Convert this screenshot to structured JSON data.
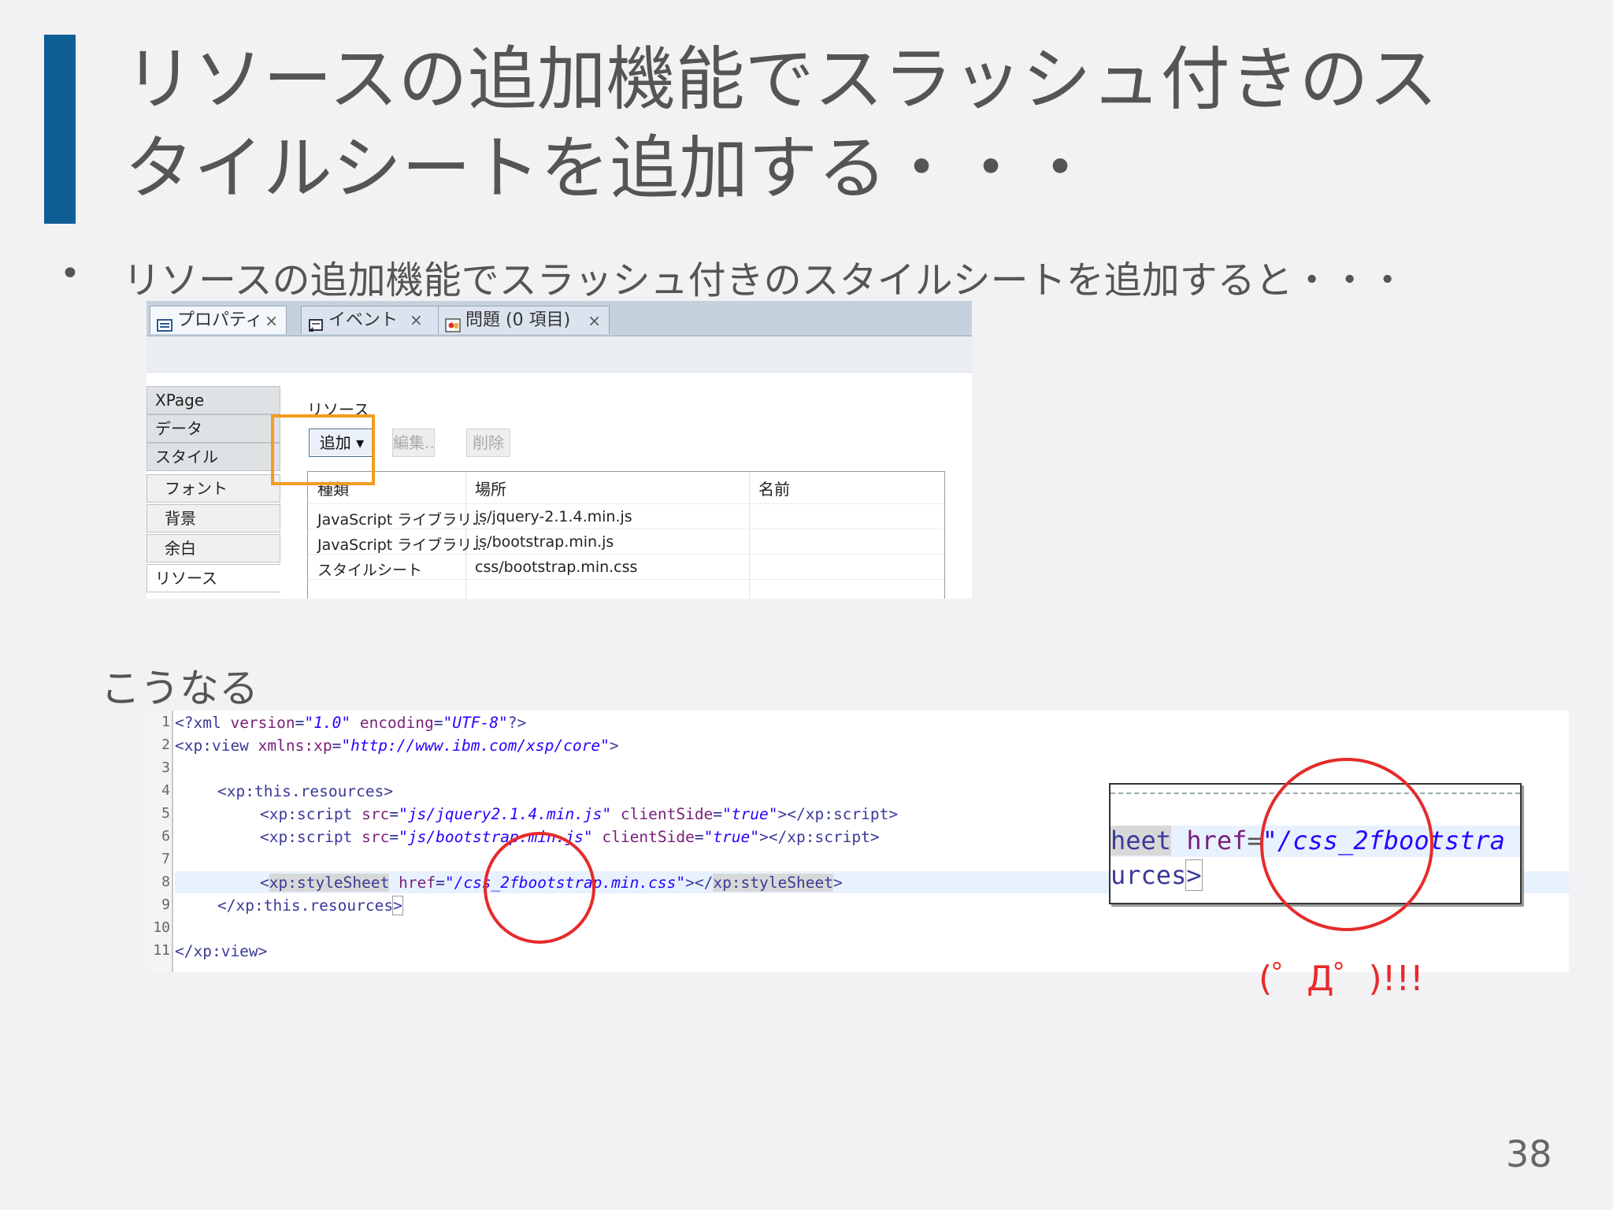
{
  "slide": {
    "title_line1": "リソースの追加機能でスラッシュ付きのス",
    "title_line2": "タイルシートを追加する・・・",
    "bullet": "リソースの追加機能でスラッシュ付きのスタイルシートを追加すると・・・",
    "caption": "こうなる",
    "exclaim": "(゜Д゜)!!!",
    "page_number": "38",
    "accent_color": "#0f5e96",
    "highlight_color": "#f39c1e",
    "circle_color": "#e52b2b"
  },
  "properties": {
    "tabs": [
      {
        "label": "プロパティ",
        "icon": "properties-icon"
      },
      {
        "label": "イベント",
        "icon": "events-icon"
      },
      {
        "label": "問題 (0 項目)",
        "icon": "problems-icon"
      }
    ],
    "close_glyph": "×",
    "nav": [
      "XPage",
      "データ",
      "スタイル",
      "フォント",
      "背景",
      "余白",
      "リソース"
    ],
    "section_label": "リソース",
    "buttons": {
      "add": "追加 ▾",
      "edit": "編集...",
      "delete": "削除"
    },
    "table": {
      "headers": [
        "種類",
        "場所",
        "名前"
      ],
      "rows": [
        [
          "JavaScript ライブラリ...",
          "js/jquery-2.1.4.min.js",
          ""
        ],
        [
          "JavaScript ライブラリ...",
          "js/bootstrap.min.js",
          ""
        ],
        [
          "スタイルシート",
          "css/bootstrap.min.css",
          ""
        ]
      ]
    }
  },
  "code": {
    "line_numbers": [
      "1",
      "2",
      "3",
      "4",
      "5",
      "6",
      "7",
      "8",
      "9",
      "10",
      "11"
    ],
    "l1": {
      "a": "<?xml ",
      "b": "version",
      "c": "=",
      "d": "\"1.0\"",
      "e": " encoding",
      "f": "=",
      "g": "\"UTF-8\"",
      "h": "?>"
    },
    "l2": {
      "a": "<xp:view ",
      "b": "xmlns:xp",
      "c": "=",
      "d": "\"http://www.ibm.com/xsp/core\"",
      "e": ">"
    },
    "l4": {
      "a": "<xp:this.resources>"
    },
    "l5": {
      "a": "<xp:script ",
      "b": "src",
      "c": "=",
      "d": "\"js/jquery2.1.4.min.js\"",
      "e": " clientSide",
      "f": "=",
      "g": "\"true\"",
      "h": "></xp:script>"
    },
    "l6": {
      "a": "<xp:script ",
      "b": "src",
      "c": "=",
      "d": "\"js/bootstrap.min.js\"",
      "e": " clientSide",
      "f": "=",
      "g": "\"true\"",
      "h": "></xp:script>"
    },
    "l8": {
      "a": "<",
      "b": "xp:styleSheet",
      "c": " ",
      "d": "href",
      "e": "=",
      "f": "\"/css_2fbootstrap.min.css\"",
      "g": "></",
      "h": "xp:styleSheet",
      "i": ">"
    },
    "l9": {
      "a": "</xp:this.resources",
      "b": ">"
    },
    "l11": {
      "a": "</xp:view>"
    }
  },
  "zoom": {
    "line1": "heet",
    "line1_attr": " href",
    "line1_eq": "=",
    "line1_str": "\"/css_2fbootstra",
    "line2": "urces",
    "line2_end": ">"
  }
}
